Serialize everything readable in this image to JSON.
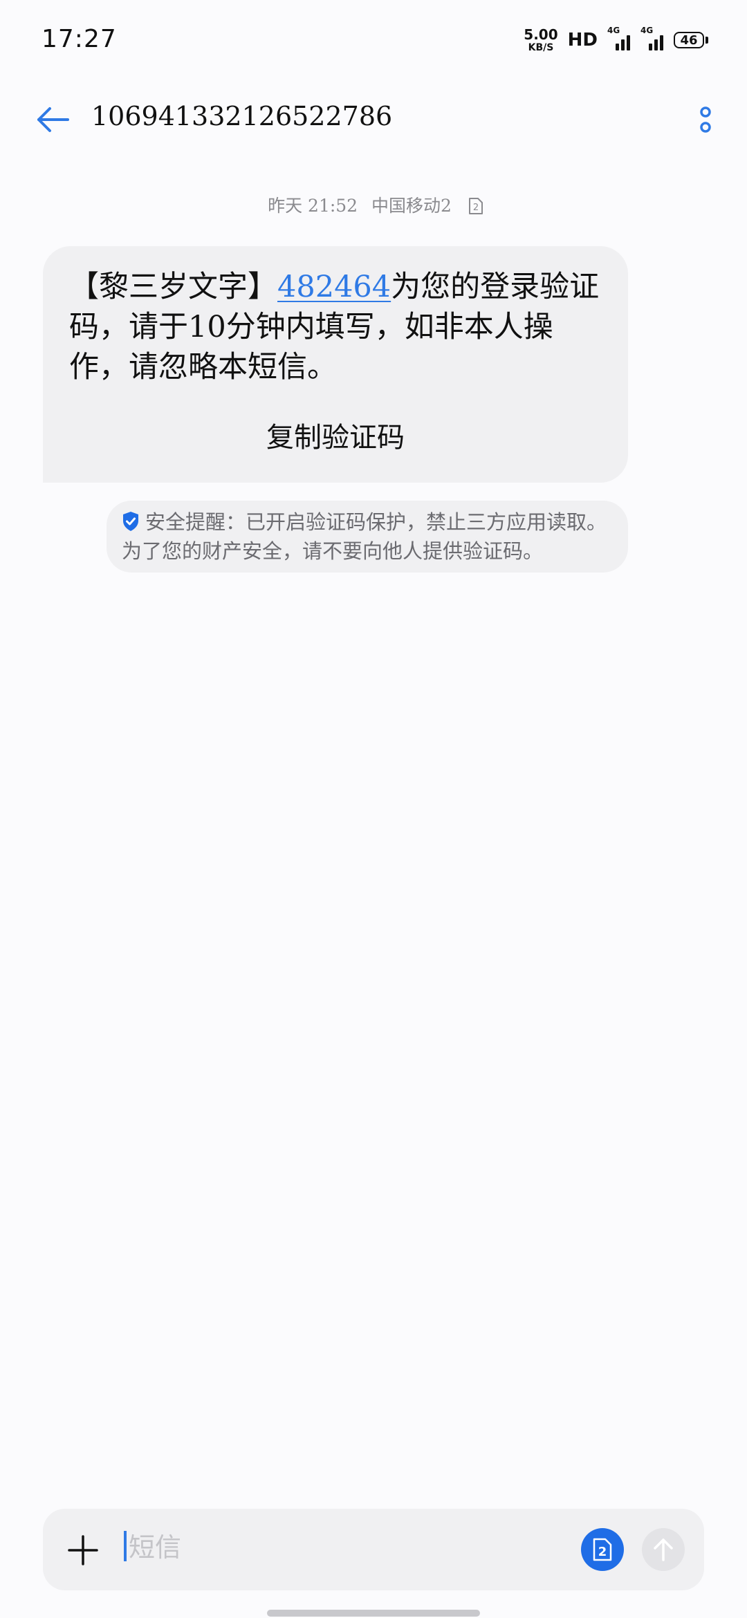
{
  "status_bar": {
    "time": "17:27",
    "net_speed_value": "5.00",
    "net_speed_unit": "KB/S",
    "hd": "HD",
    "sim1_label": "4G",
    "sim2_label": "4G",
    "battery": "46"
  },
  "header": {
    "title": "106941332126522786",
    "back_icon": "arrow-left-icon",
    "more_icon": "more-vertical-icon"
  },
  "conversation": {
    "meta_date": "昨天 21:52",
    "meta_carrier": "中国移动2",
    "meta_sim_badge": "2",
    "message": {
      "prefix": "【黎三岁文字】",
      "code": "482464",
      "body": "为您的登录验证码，请于10分钟内填写，如非本人操作，请忽略本短信。",
      "copy_button": "复制验证码"
    },
    "security_notice": "安全提醒：已开启验证码保护，禁止三方应用读取。为了您的财产安全，请不要向他人提供验证码。"
  },
  "composer": {
    "placeholder": "短信",
    "sim_badge": "2",
    "plus_icon": "plus-icon",
    "send_icon": "arrow-up-icon"
  },
  "colors": {
    "accent": "#2f7ae5",
    "sim_button": "#1f6de6",
    "bubble": "#f0f0f2",
    "background": "#fbfbfd"
  }
}
